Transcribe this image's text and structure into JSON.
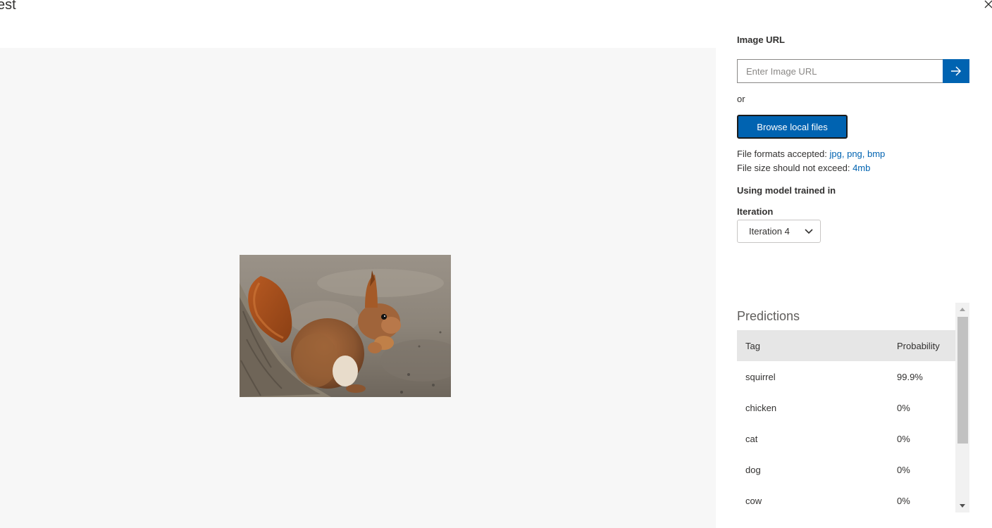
{
  "dialog": {
    "title": "est"
  },
  "image_url": {
    "label": "Image URL",
    "placeholder": "Enter Image URL",
    "value": ""
  },
  "or_text": "or",
  "browse_button": "Browse local files",
  "file_formats": {
    "label": "File formats accepted:",
    "formats": "jpg, png, bmp"
  },
  "file_size": {
    "label": "File size should not exceed:",
    "value": "4mb"
  },
  "model_heading": "Using model trained in",
  "iteration": {
    "label": "Iteration",
    "selected": "Iteration 4"
  },
  "predictions": {
    "title": "Predictions",
    "columns": {
      "tag": "Tag",
      "probability": "Probability"
    },
    "rows": [
      {
        "tag": "squirrel",
        "probability": "99.9%"
      },
      {
        "tag": "chicken",
        "probability": "0%"
      },
      {
        "tag": "cat",
        "probability": "0%"
      },
      {
        "tag": "dog",
        "probability": "0%"
      },
      {
        "tag": "cow",
        "probability": "0%"
      }
    ]
  },
  "colors": {
    "accent": "#0063b1",
    "preview_bg": "#f7f7f7",
    "table_header_bg": "#e6e6e6"
  },
  "icons": {
    "close": "close-icon",
    "submit": "arrow-right-icon",
    "dropdown": "chevron-down-icon"
  }
}
